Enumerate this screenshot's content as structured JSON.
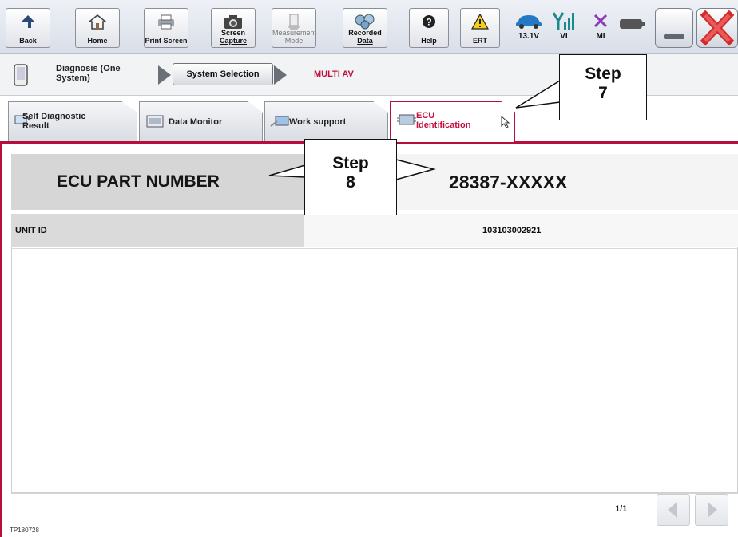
{
  "toolbar": {
    "back": {
      "label": "Back",
      "icon": "back-arrow-icon"
    },
    "home": {
      "label": "Home",
      "icon": "home-icon"
    },
    "print": {
      "label": "Print Screen",
      "icon": "printer-icon"
    },
    "capture": {
      "label_line1": "Screen",
      "label_line2": "Capture",
      "icon": "camera-icon"
    },
    "measure": {
      "label_line1": "Measurement",
      "label_line2": "Mode",
      "icon": "measurement-icon"
    },
    "recorded": {
      "label_line1": "Recorded",
      "label_line2": "Data",
      "icon": "recorded-data-icon"
    },
    "help": {
      "label": "Help",
      "icon": "help-icon"
    },
    "ert": {
      "label": "ERT",
      "icon": "warning-icon"
    },
    "battery": {
      "label": "13.1V",
      "icon": "car-icon"
    },
    "vi": {
      "label": "VI",
      "icon": "signal-icon"
    },
    "mi": {
      "label": "MI",
      "icon": "x-mark-icon"
    },
    "status_icon": "battery-status-icon",
    "colors": {
      "accent": "#b5103d",
      "close_red": "#d42a2a",
      "vi_teal": "#1b8a8f",
      "mi_purple": "#8a3ab3",
      "car_blue": "#2479c7"
    }
  },
  "breadcrumb": {
    "step1": {
      "line1": "Diagnosis (One",
      "line2": "System)"
    },
    "step2": "System Selection",
    "step3": "MULTI AV"
  },
  "tabs": [
    {
      "line1": "Self Diagnostic",
      "line2": "Result"
    },
    {
      "line1": "Data Monitor",
      "line2": ""
    },
    {
      "line1": "Work support",
      "line2": ""
    },
    {
      "line1": "ECU",
      "line2": "Identification"
    }
  ],
  "ecu": {
    "header_label": "ECU PART NUMBER",
    "part_number": "28387-XXXXX"
  },
  "table": {
    "rows": [
      {
        "label": "UNIT ID",
        "value": "103103002921"
      }
    ]
  },
  "pager": {
    "text": "1/1"
  },
  "footer": {
    "code": "TP180728"
  },
  "callouts": {
    "step7": {
      "line1": "Step",
      "line2": "7"
    },
    "step8": {
      "line1": "Step",
      "line2": "8"
    }
  }
}
